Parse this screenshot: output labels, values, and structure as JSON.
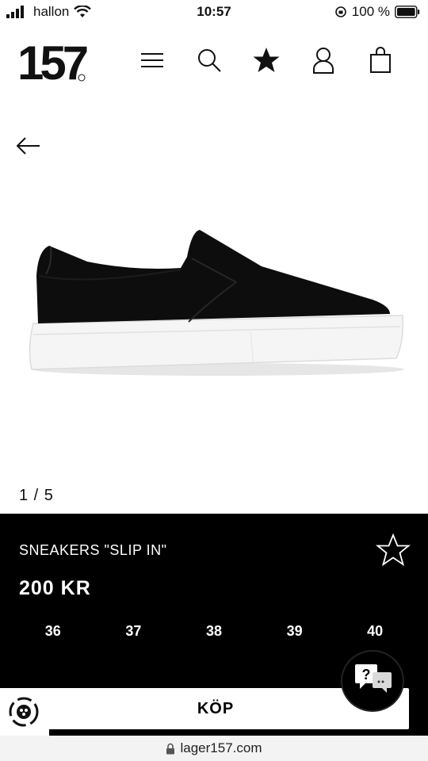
{
  "status_bar": {
    "carrier": "hallon",
    "time": "10:57",
    "battery": "100 %"
  },
  "header": {
    "logo_text": "157",
    "icons": [
      "menu-icon",
      "search-icon",
      "star-icon",
      "account-icon",
      "bag-icon"
    ]
  },
  "gallery": {
    "counter": "1 / 5"
  },
  "product": {
    "name": "SNEAKERS \"SLIP IN\"",
    "price": "200 KR",
    "sizes": [
      "36",
      "37",
      "38",
      "39",
      "40"
    ],
    "buy_label": "KÖP"
  },
  "browser": {
    "url": "lager157.com"
  },
  "colors": {
    "panel_bg": "#000000",
    "text_on_panel": "#ffffff"
  }
}
